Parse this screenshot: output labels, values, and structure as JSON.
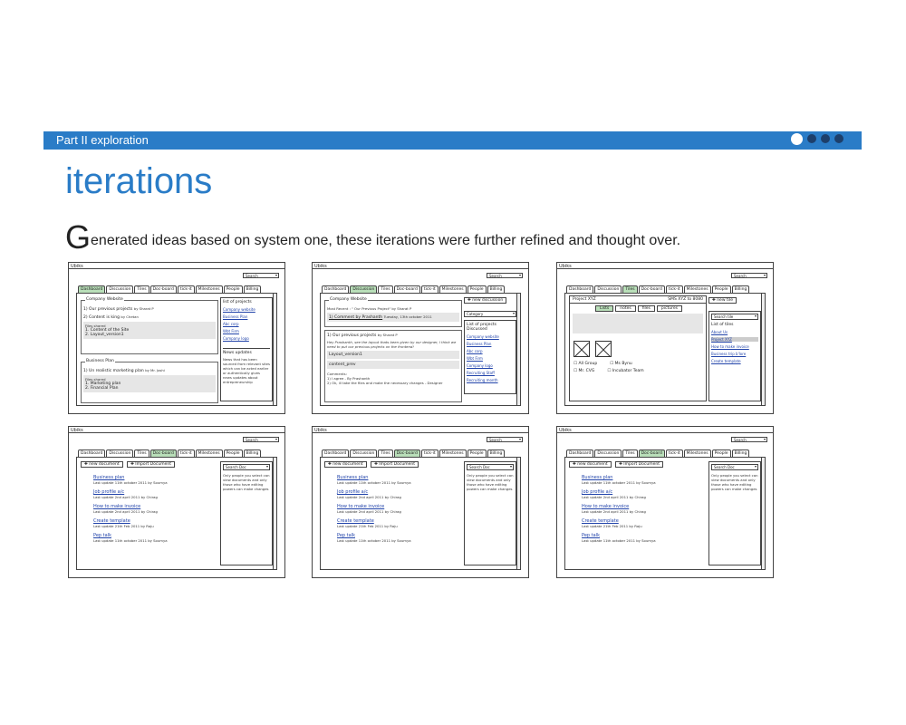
{
  "header": {
    "band_title": "Part II exploration",
    "heading": "iterations",
    "intro_cap": "G",
    "intro_rest": "enerated ideas based on system one, these iterations were further refined and thought over."
  },
  "colors": {
    "accent": "#2a7cc7",
    "dot": "#1d3f6b",
    "active_tab": "#b9dfb9"
  },
  "wireframes": {
    "app_name": "Ubiks",
    "search": "Search",
    "tabs": [
      "Dashboard",
      "Discussion",
      "Tiles",
      "Doc-board",
      "tick-it",
      "Milestones",
      "People",
      "Billing"
    ],
    "w1": {
      "box1_title": "Company Website",
      "box1_l1": "1) Our previous projects",
      "box1_l1_by": "by Sharat P",
      "box1_l2": "2) Content is king",
      "box1_l2_by": "by Chetan",
      "files_shared": "Files shared",
      "box1_f1": "1. Content of the Site",
      "box1_f2": "2. Layout_version1",
      "box2_title": "Business Plan",
      "box2_l1": "1) Un realistic marketing plan",
      "box2_l1_by": "by Mr. Joshi",
      "box2_f1": "1. Marketing plan",
      "box2_f2": "2. Financial Plan",
      "side_head": "list of projects",
      "side_items": [
        "Company website",
        "Business Plan",
        "Abc corp",
        "Wbt Firm",
        "Company logo"
      ],
      "news_head": "News updates",
      "news_text": "News that has been sourced from relevant sites which can be acted earlier or authentically gives news updates about entrepreneurship"
    },
    "w2": {
      "title": "Company Website",
      "recent": "Most Recent : \" Our Previous Project\" by Sharat P",
      "comment": "1) Comment by Prashanth",
      "comment_date": "Tuesday, 13th october 2011",
      "l1": "1) Our previous projects",
      "l1_by": "by Sharat P",
      "quote": "Hey Prashanth, see the layout thats been given by our designer, I think we need to put our previous projects on the frontend!",
      "file1": "Layout_version1",
      "file2": "content_prev",
      "comments": "Comments:",
      "c1": "1) I agree - By Prashanth",
      "c2": "2) Ok, ill take the files and make the necessary changes - Designer",
      "new_btn": "new discussion",
      "category": "Category",
      "side_head": "List of projects Discussed",
      "side_items": [
        "Company website",
        "Business Plan",
        "Abc corp",
        "Wbt Firm",
        "Company logo",
        "Recruiting Staff",
        "Recruiting month"
      ]
    },
    "w3": {
      "project": "Project XYZ",
      "sms": "SMS XYZ to 8080",
      "subtabs": [
        "Lists",
        "notes",
        "files",
        "pictures"
      ],
      "checks": [
        "All Group",
        "Mr. CVG",
        "Ms Bynu",
        "Incubator Team"
      ],
      "new_btn": "new tile",
      "search_tile": "Search tile",
      "side_head": "List of tiles",
      "side_items": [
        "About Us",
        "Project XYZ",
        "How to make invoice",
        "Business trip b'lore",
        "Create template"
      ]
    },
    "doc": {
      "new_btn": "new document",
      "import_btn": "Import Document",
      "search_doc": "Search Doc",
      "note": "Only people you select can view documents and only those who have editing powers can make changes",
      "docs": [
        {
          "title": "Business plan",
          "meta": "Last update 11th october 2011 by Soumya"
        },
        {
          "title": "Job profile a/c",
          "meta": "Last update 2nd april 2011 by Chirag"
        },
        {
          "title": "How to make invoice",
          "meta": "Last update 2nd april 2011 by Chirag"
        },
        {
          "title": "Create template",
          "meta": "Last update 21th Feb 2011 by Raju"
        },
        {
          "title": "Pep talk",
          "meta": "Last update 11th october 2011 by Soumya"
        }
      ]
    }
  }
}
